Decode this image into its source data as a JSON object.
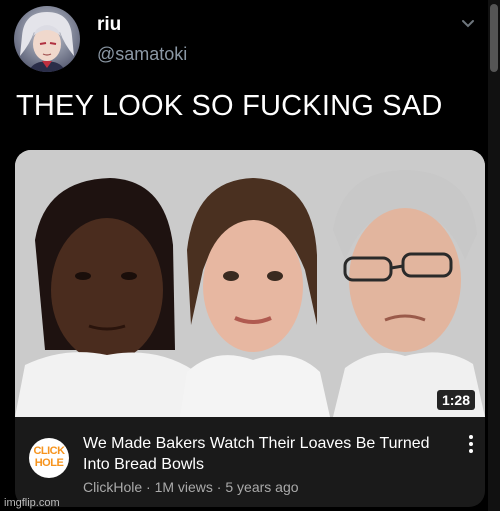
{
  "tweet": {
    "display_name": "riu",
    "handle": "@samatoki",
    "text": "THEY LOOK SO FUCKING SAD"
  },
  "embed": {
    "video_title": "We Made Bakers Watch Their Loaves Be Turned Into Bread Bowls",
    "channel_logo_line1": "CLICK",
    "channel_logo_line2": "HOLE",
    "meta": "ClickHole · 1M views · 5 years ago",
    "duration": "1:28"
  },
  "watermark": "imgflip.com",
  "icons": {
    "chevron": "chevron-down-icon",
    "more": "more-vertical-icon"
  },
  "colors": {
    "background": "#000000",
    "handle_gray": "#8b98a5",
    "card_bg": "#1a1a1a",
    "clickhole_orange": "#f7941d"
  }
}
